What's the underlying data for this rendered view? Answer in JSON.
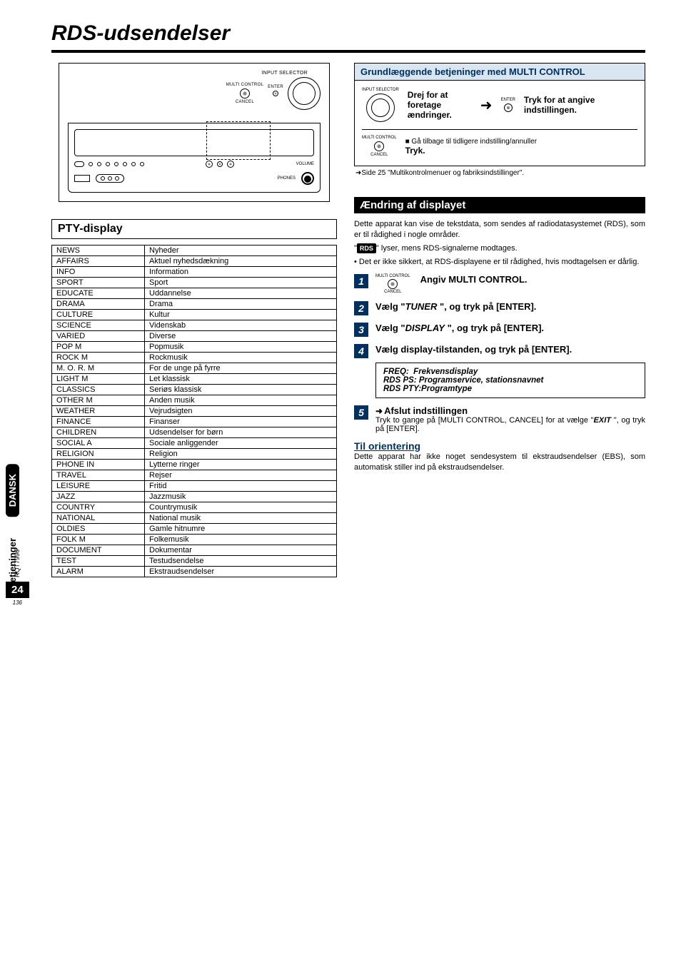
{
  "page": {
    "title": "RDS-udsendelser",
    "side_tab_dark": "DANSK",
    "side_tab_light": "Betjeninger",
    "doc_id": "RQT7996",
    "page_number": "24",
    "sub_page": "136"
  },
  "device": {
    "input_selector_label": "INPUT SELECTOR",
    "multi_control_label": "MULTI CONTROL",
    "enter_label": "ENTER",
    "cancel_label": "CANCEL",
    "phones_label": "PHONES",
    "volume_label": "VOLUME"
  },
  "pty": {
    "heading": "PTY-display",
    "rows": [
      [
        "NEWS",
        "Nyheder"
      ],
      [
        "AFFAIRS",
        "Aktuel nyhedsdækning"
      ],
      [
        "INFO",
        "Information"
      ],
      [
        "SPORT",
        "Sport"
      ],
      [
        "EDUCATE",
        "Uddannelse"
      ],
      [
        "DRAMA",
        "Drama"
      ],
      [
        "CULTURE",
        "Kultur"
      ],
      [
        "SCIENCE",
        "Videnskab"
      ],
      [
        "VARIED",
        "Diverse"
      ],
      [
        "POP M",
        "Popmusik"
      ],
      [
        "ROCK M",
        "Rockmusik"
      ],
      [
        "M. O. R. M",
        "For de unge på fyrre"
      ],
      [
        "LIGHT M",
        "Let klassisk"
      ],
      [
        "CLASSICS",
        "Seriøs klassisk"
      ],
      [
        "OTHER M",
        "Anden musik"
      ],
      [
        "WEATHER",
        "Vejrudsigten"
      ],
      [
        "FINANCE",
        "Finanser"
      ],
      [
        "CHILDREN",
        "Udsendelser for børn"
      ],
      [
        "SOCIAL A",
        "Sociale anliggender"
      ],
      [
        "RELIGION",
        "Religion"
      ],
      [
        "PHONE IN",
        "Lytterne ringer"
      ],
      [
        "TRAVEL",
        "Rejser"
      ],
      [
        "LEISURE",
        "Fritid"
      ],
      [
        "JAZZ",
        "Jazzmusik"
      ],
      [
        "COUNTRY",
        "Countrymusik"
      ],
      [
        "NATIONAL",
        "National musik"
      ],
      [
        "OLDIES",
        "Gamle hitnumre"
      ],
      [
        "FOLK M",
        "Folkemusik"
      ],
      [
        "DOCUMENT",
        "Dokumentar"
      ],
      [
        "TEST",
        "Testudsendelse"
      ],
      [
        "ALARM",
        "Ekstraudsendelser"
      ]
    ]
  },
  "multi": {
    "heading": "Grundlæggende betjeninger med MULTI CONTROL",
    "input_selector": "INPUT SELECTOR",
    "turn_text": "Drej for at foretage ændringer.",
    "enter": "ENTER",
    "press_text": "Tryk for at angive indstillingen.",
    "back_label_top": "MULTI CONTROL",
    "back_label_bottom": "CANCEL",
    "back_bullet": "■ Gå tilbage til tidligere indstilling/annuller",
    "back_action": "Tryk.",
    "ref_note": "➜Side 25 \"Multikontrolmenuer og fabriksindstillinger\"."
  },
  "change": {
    "heading": "Ændring af displayet",
    "p1": "Dette apparat kan vise de tekstdata, som sendes af radiodatasystemet (RDS), som er til rådighed i nogle områder.",
    "p2_pre": "\"",
    "p2_badge": "RDS",
    "p2_post": "\" lyser, mens RDS-signalerne modtages.",
    "p3": "• Det er ikke sikkert, at RDS-displayene er til rådighed, hvis modtagelsen er dårlig.",
    "step1_icon_top": "MULTI CONTROL",
    "step1_icon_bottom": "CANCEL",
    "step1": "Angiv MULTI CONTROL.",
    "step2_pre": "Vælg \"",
    "step2_cmd": "TUNER",
    "step2_post": " \", og tryk på [ENTER].",
    "step3_pre": "Vælg \"",
    "step3_cmd": "DISPLAY",
    "step3_post": " \", og tryk på [ENTER].",
    "step4": "Vælg display-tilstanden, og tryk på [ENTER].",
    "modes": {
      "l1a": "FREQ:",
      "l1b": "Frekvensdisplay",
      "l2a": "RDS PS:",
      "l2b": "Programservice, stationsnavnet",
      "l3a": "RDS PTY:",
      "l3b": "Programtype"
    },
    "step5_title": "Afslut indstillingen",
    "step5_body_pre": "Tryk to gange på [MULTI CONTROL, CANCEL] for at vælge \"",
    "step5_body_cmd": "EXIT",
    "step5_body_post": " \", og tryk på [ENTER].",
    "orient_head": "Til orientering",
    "orient_body": "Dette apparat har ikke noget sendesystem til ekstraudsendelser (EBS), som automatisk stiller ind på ekstraudsendelser."
  }
}
